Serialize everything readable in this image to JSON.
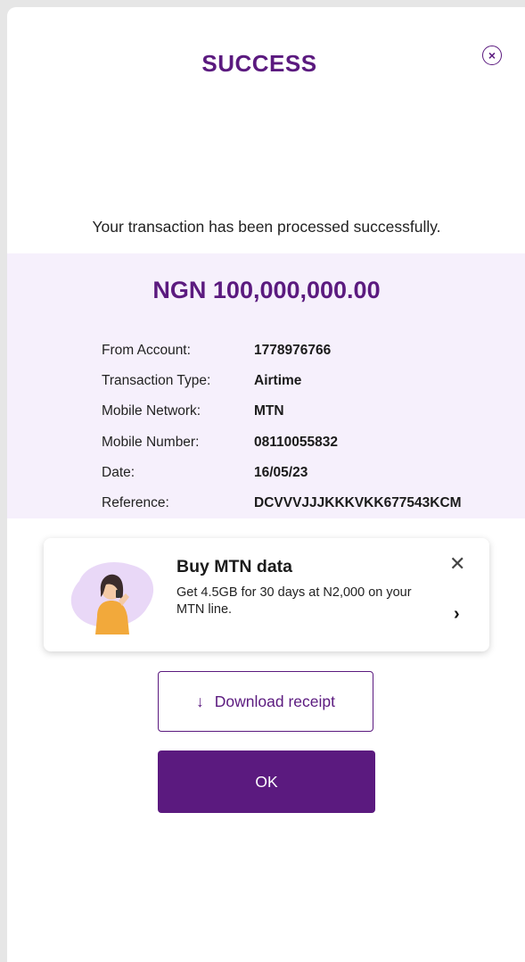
{
  "header": {
    "title": "SUCCESS",
    "close_icon": "close-circle-icon"
  },
  "message": "Your transaction has been processed successfully.",
  "summary": {
    "amount": "NGN 100,000,000.00",
    "rows": [
      {
        "label": "From Account:",
        "value": "1778976766"
      },
      {
        "label": "Transaction Type:",
        "value": "Airtime"
      },
      {
        "label": "Mobile Network:",
        "value": "MTN"
      },
      {
        "label": "Mobile Number:",
        "value": "08110055832"
      },
      {
        "label": "Date:",
        "value": "16/05/23"
      },
      {
        "label": "Reference:",
        "value": "DCVVVJJJKKKVKK677543KCM"
      }
    ]
  },
  "promo": {
    "title": "Buy MTN data",
    "description": "Get 4.5GB for 30 days at N2,000 on your MTN line.",
    "close_glyph": "✕",
    "arrow_glyph": "›"
  },
  "actions": {
    "download_label": "Download receipt",
    "download_icon_glyph": "↓",
    "ok_label": "OK"
  },
  "colors": {
    "brand": "#5b1a7f",
    "summary_bg": "#f6f0fc"
  }
}
